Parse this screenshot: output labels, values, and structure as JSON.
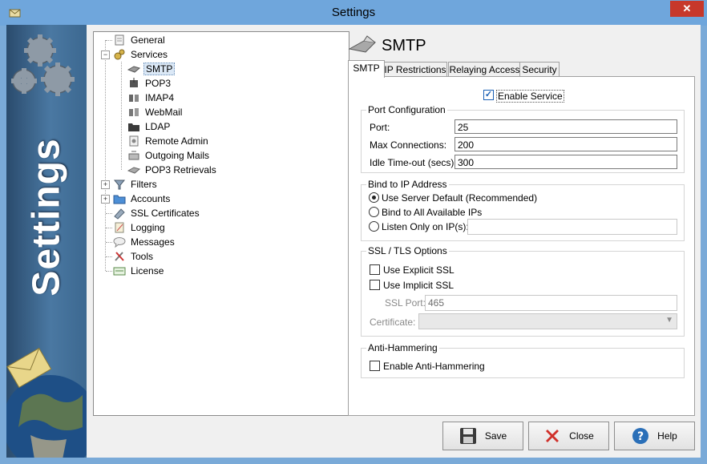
{
  "window": {
    "title": "Settings"
  },
  "banner": {
    "text": "Settings"
  },
  "tree": [
    {
      "label": "General",
      "icon": "general-icon"
    },
    {
      "label": "Services",
      "icon": "services-icon"
    },
    {
      "label": "SMTP",
      "icon": "smtp-icon"
    },
    {
      "label": "POP3",
      "icon": "pop3-icon"
    },
    {
      "label": "IMAP4",
      "icon": "imap4-icon"
    },
    {
      "label": "WebMail",
      "icon": "webmail-icon"
    },
    {
      "label": "LDAP",
      "icon": "ldap-icon"
    },
    {
      "label": "Remote Admin",
      "icon": "remote-admin-icon"
    },
    {
      "label": "Outgoing Mails",
      "icon": "outgoing-mails-icon"
    },
    {
      "label": "POP3 Retrievals",
      "icon": "pop3-retrievals-icon"
    },
    {
      "label": "Filters",
      "icon": "filters-icon"
    },
    {
      "label": "Accounts",
      "icon": "accounts-icon"
    },
    {
      "label": "SSL Certificates",
      "icon": "ssl-certificates-icon"
    },
    {
      "label": "Logging",
      "icon": "logging-icon"
    },
    {
      "label": "Messages",
      "icon": "messages-icon"
    },
    {
      "label": "Tools",
      "icon": "tools-icon"
    },
    {
      "label": "License",
      "icon": "license-icon"
    }
  ],
  "header": {
    "title": "SMTP"
  },
  "tabs": [
    {
      "label": "SMTP"
    },
    {
      "label": "IP Restrictions"
    },
    {
      "label": "Relaying Access"
    },
    {
      "label": "Security"
    }
  ],
  "smtp": {
    "enable_service": "Enable Service",
    "port_config": {
      "title": "Port Configuration",
      "port_label": "Port:",
      "port_value": "25",
      "max_conn_label": "Max Connections:",
      "max_conn_value": "200",
      "idle_label": "Idle Time-out (secs):",
      "idle_value": "300"
    },
    "bind": {
      "title": "Bind to IP Address",
      "opt1": "Use Server Default (Recommended)",
      "opt2": "Bind to All Available IPs",
      "opt3": "Listen Only on IP(s):",
      "ip_value": ""
    },
    "ssl": {
      "title": "SSL / TLS Options",
      "explicit": "Use Explicit SSL",
      "implicit": "Use Implicit SSL",
      "port_label": "SSL Port:",
      "port_value": "465",
      "cert_label": "Certificate:",
      "cert_value": ""
    },
    "anti": {
      "title": "Anti-Hammering",
      "enable": "Enable Anti-Hammering"
    }
  },
  "buttons": {
    "save": "Save",
    "close": "Close",
    "help": "Help"
  }
}
